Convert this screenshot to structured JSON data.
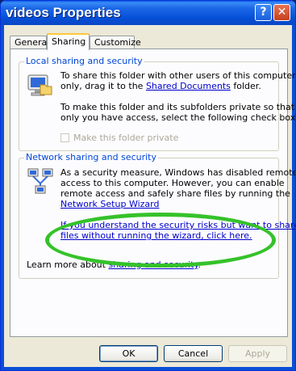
{
  "window": {
    "title": "videos Properties"
  },
  "titlebar": {
    "help_glyph": "?",
    "close_glyph": "✕"
  },
  "tabs": [
    {
      "label": "General"
    },
    {
      "label": "Sharing",
      "active": true
    },
    {
      "label": "Customize"
    }
  ],
  "local_sharing": {
    "legend": "Local sharing and security",
    "line1": "To share this folder with other users of this computer",
    "line2_prefix": "only, drag it to the ",
    "line2_link": "Shared Documents",
    "line2_suffix": " folder.",
    "line3": "To make this folder and its subfolders private so that",
    "line4": "only you have access, select the following check box.",
    "private_checkbox_label": "Make this folder private",
    "private_checked": false
  },
  "network_sharing": {
    "legend": "Network sharing and security",
    "line1": "As a security measure, Windows has disabled remote",
    "line2": "access to this computer. However, you can enable",
    "line3": "remote access and safely share files by running the",
    "wizard_link": "Network Setup Wizard",
    "risk_link_line1": "If you understand the security risks but want to share",
    "risk_link_line2": "files without running the wizard, click here.",
    "learn_more_prefix": "Learn more about ",
    "learn_more_link": "sharing and security",
    "learn_more_suffix": "."
  },
  "icons": {
    "local": "computer-with-folder-icon",
    "network": "network-computers-icon"
  },
  "colors": {
    "highlight_oval": "#35c22a",
    "link": "#0000cc",
    "group_legend": "#0046d5"
  },
  "buttons": {
    "ok": "OK",
    "cancel": "Cancel",
    "apply": "Apply"
  }
}
